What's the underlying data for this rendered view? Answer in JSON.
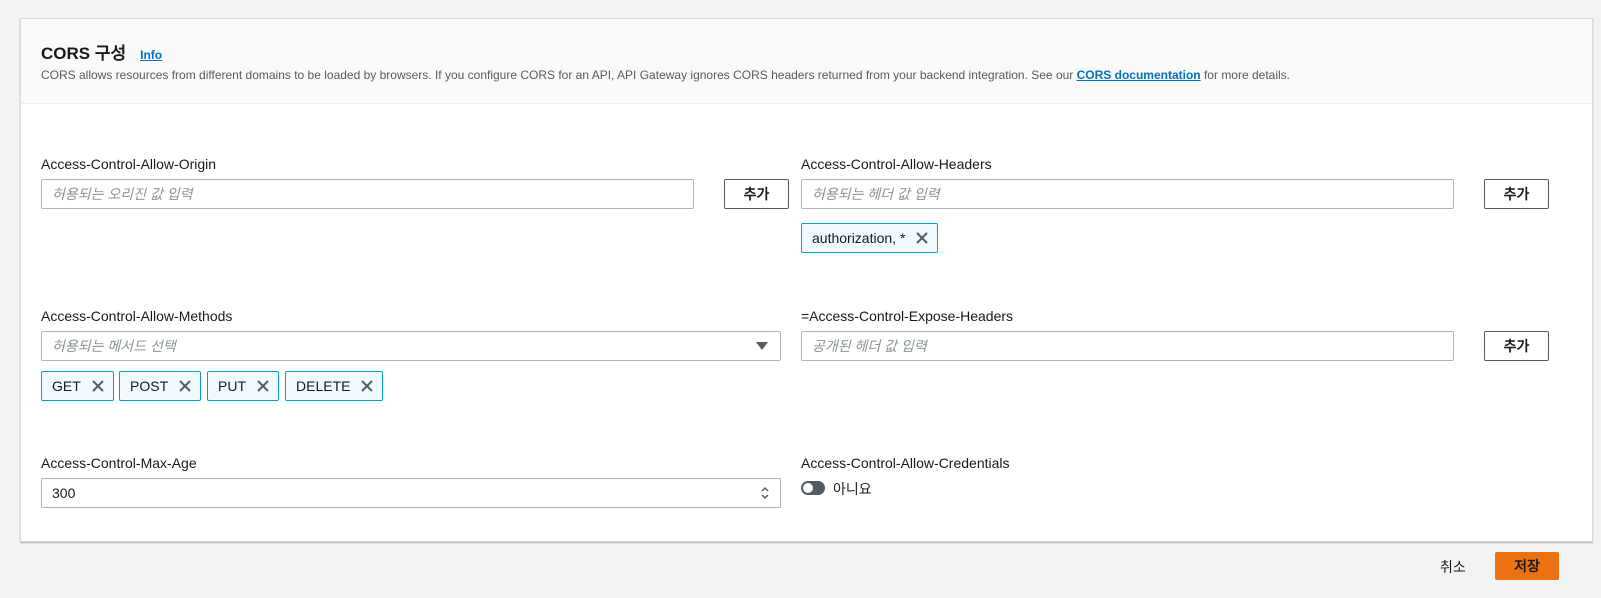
{
  "header": {
    "title": "CORS 구성",
    "info_label": "Info",
    "description_before": "CORS allows resources from different domains to be loaded by browsers. If you configure CORS for an API, API Gateway ignores CORS headers returned from your backend integration. See our ",
    "description_link": "CORS documentation",
    "description_after": " for more details."
  },
  "allow_origin": {
    "label": "Access-Control-Allow-Origin",
    "placeholder": "허용되는 오리진 값 입력",
    "add_label": "추가"
  },
  "allow_headers": {
    "label": "Access-Control-Allow-Headers",
    "placeholder": "허용되는 헤더 값 입력",
    "add_label": "추가",
    "tokens": [
      "authorization, *"
    ]
  },
  "allow_methods": {
    "label": "Access-Control-Allow-Methods",
    "placeholder": "허용되는 메서드 선택",
    "tokens": [
      "GET",
      "POST",
      "PUT",
      "DELETE"
    ]
  },
  "expose_headers": {
    "label": "=Access-Control-Expose-Headers",
    "placeholder": "공개된 헤더 값 입력",
    "add_label": "추가"
  },
  "max_age": {
    "label": "Access-Control-Max-Age",
    "value": "300"
  },
  "allow_credentials": {
    "label": "Access-Control-Allow-Credentials",
    "toggle_label": "아니요",
    "enabled": false
  },
  "footer": {
    "cancel_label": "취소",
    "save_label": "저장"
  },
  "colors": {
    "accent": "#ec7211",
    "link": "#0073bb",
    "token_border": "#00a1c9"
  },
  "icons": {
    "dropdown": "caret-down-icon",
    "remove": "close-icon",
    "stepper": "stepper-icon"
  }
}
